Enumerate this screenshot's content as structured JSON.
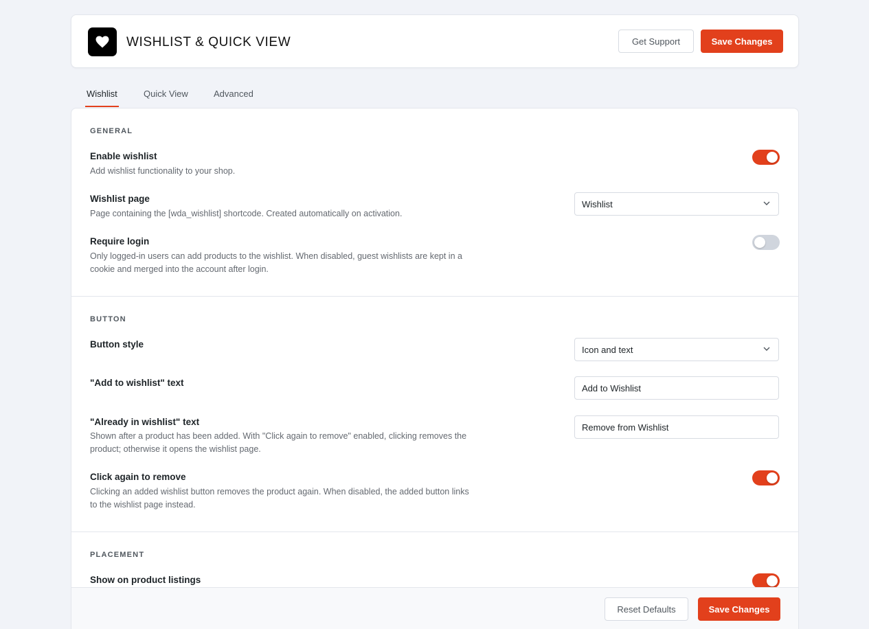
{
  "header": {
    "title": "WISHLIST & QUICK VIEW",
    "logo_icon": "heart-icon",
    "get_support_label": "Get Support",
    "save_label": "Save Changes"
  },
  "tabs": [
    {
      "label": "Wishlist",
      "active": true
    },
    {
      "label": "Quick View",
      "active": false
    },
    {
      "label": "Advanced",
      "active": false
    }
  ],
  "sections": {
    "general": {
      "title": "GENERAL",
      "enable_wishlist": {
        "label": "Enable wishlist",
        "desc": "Add wishlist functionality to your shop.",
        "enabled": true
      },
      "wishlist_page": {
        "label": "Wishlist page",
        "desc": "Page containing the [wda_wishlist] shortcode. Created automatically on activation.",
        "value": "Wishlist"
      },
      "require_login": {
        "label": "Require login",
        "desc": "Only logged-in users can add products to the wishlist. When disabled, guest wishlists are kept in a cookie and merged into the account after login.",
        "enabled": false
      }
    },
    "button": {
      "title": "BUTTON",
      "button_style": {
        "label": "Button style",
        "value": "Icon and text"
      },
      "add_text": {
        "label": "\"Add to wishlist\" text",
        "value": "Add to Wishlist"
      },
      "already_text": {
        "label": "\"Already in wishlist\" text",
        "desc": "Shown after a product has been added. With \"Click again to remove\" enabled, clicking removes the product; otherwise it opens the wishlist page.",
        "value": "Remove from Wishlist"
      },
      "click_again": {
        "label": "Click again to remove",
        "desc": "Clicking an added wishlist button removes the product again. When disabled, the added button links to the wishlist page instead.",
        "enabled": true
      }
    },
    "placement": {
      "title": "PLACEMENT",
      "show_on_listings": {
        "label": "Show on product listings",
        "enabled": true
      }
    }
  },
  "footer": {
    "reset_label": "Reset Defaults",
    "save_label": "Save Changes"
  },
  "colors": {
    "accent": "#e2401c",
    "background": "#f1f3f8",
    "toggle_off": "#d0d5dd"
  }
}
